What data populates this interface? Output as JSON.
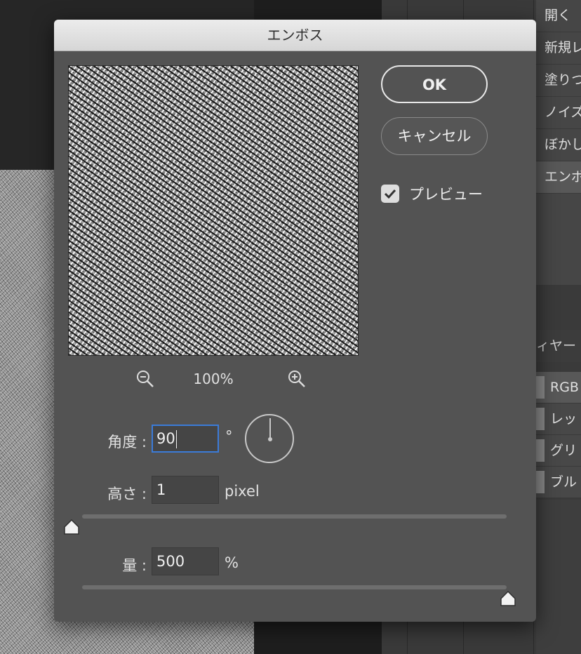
{
  "history_panel": {
    "items": [
      {
        "label": "開く",
        "active": false
      },
      {
        "label": "新規レ",
        "active": false
      },
      {
        "label": "塗りつ",
        "active": false
      },
      {
        "label": "ノイズ",
        "active": false
      },
      {
        "label": "ぼかし",
        "active": false
      },
      {
        "label": "エンボ",
        "active": true
      }
    ]
  },
  "layers_panel": {
    "header": "ィヤー"
  },
  "channels": [
    "RGB",
    "レッ",
    "グリ",
    "ブル"
  ],
  "dialog": {
    "title": "エンボス",
    "ok_label": "OK",
    "cancel_label": "キャンセル",
    "preview_label": "プレビュー",
    "preview_checked": true,
    "zoom": "100%",
    "angle": {
      "label": "角度 :",
      "value": "90",
      "unit": "°"
    },
    "height": {
      "label": "高さ :",
      "value": "1",
      "unit": "pixel",
      "slider_fraction": 0.0
    },
    "amount": {
      "label": "量 :",
      "value": "500",
      "unit": "%",
      "slider_fraction": 1.0
    }
  },
  "colors": {
    "dialog_bg": "#535353",
    "focus_ring": "#3b7bd8",
    "titlebar": "#e0e0e0"
  }
}
